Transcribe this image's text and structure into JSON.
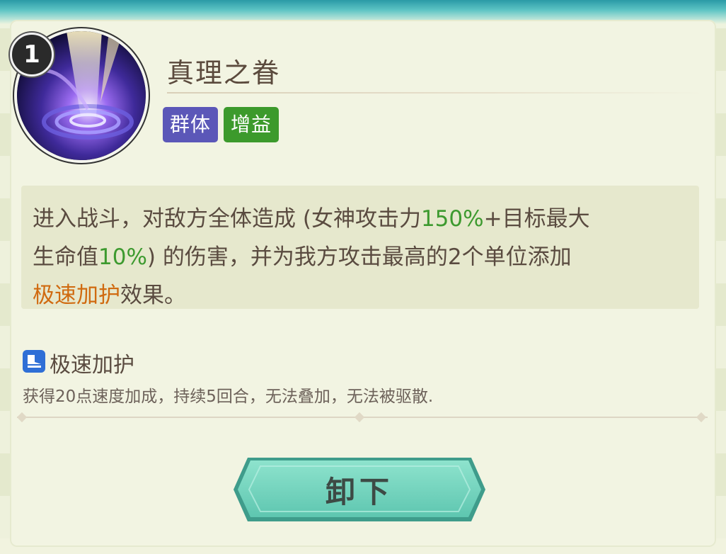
{
  "skill": {
    "level": "1",
    "name": "真理之眷",
    "tags": [
      "群体",
      "增益"
    ],
    "description": {
      "p1": "进入战斗，对敌方全体造成 (女神攻击力",
      "p2": "150%",
      "p3": "+目标最大",
      "p4": "生命值",
      "p5": "10%",
      "p6": ") 的伤害，并为我方攻击最高的2个单位添加",
      "p7": "极速加护",
      "p8": "效果。"
    }
  },
  "effect": {
    "name": "极速加护",
    "description": "获得20点速度加成，持续5回合，无法叠加，无法被驱散.",
    "icon": "speed-boot-icon"
  },
  "button": {
    "label": "卸下"
  },
  "colors": {
    "tag_group": "#5b57b8",
    "tag_buff": "#3c9a2c",
    "highlight_green": "#3d9a2f",
    "highlight_orange": "#d06a10",
    "button": "#6ed3bd"
  }
}
